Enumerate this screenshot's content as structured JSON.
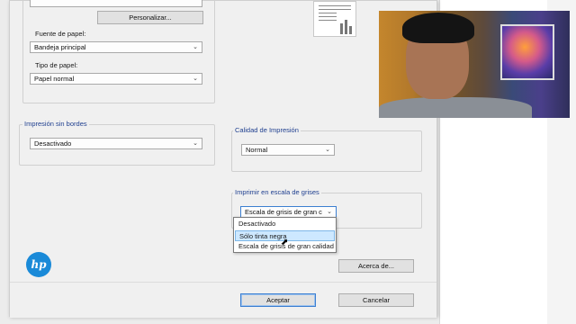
{
  "print_settings": {
    "customize_button": "Personalizar...",
    "paper_source": {
      "label": "Fuente de papel:",
      "value": "Bandeja principal"
    },
    "paper_type": {
      "label": "Tipo de papel:",
      "value": "Papel normal"
    }
  },
  "borderless": {
    "legend": "Impresión sin bordes",
    "value": "Desactivado"
  },
  "quality": {
    "legend": "Calidad de Impresión",
    "value": "Normal"
  },
  "grayscale": {
    "legend": "Imprimir en escala de grises",
    "value": "Escala de grisis de gran c",
    "options": [
      "Desactivado",
      "Sólo tinta negra",
      "Escala de grisis de gran calidad"
    ],
    "selected_index": 1
  },
  "about_button": "Acerca de...",
  "footer": {
    "accept": "Aceptar",
    "cancel": "Cancelar"
  },
  "brand": {
    "logo": "hp"
  },
  "colors": {
    "accent": "#1a8ad8",
    "legend_text": "#1f3f8f",
    "selection": "#cde8ff"
  }
}
